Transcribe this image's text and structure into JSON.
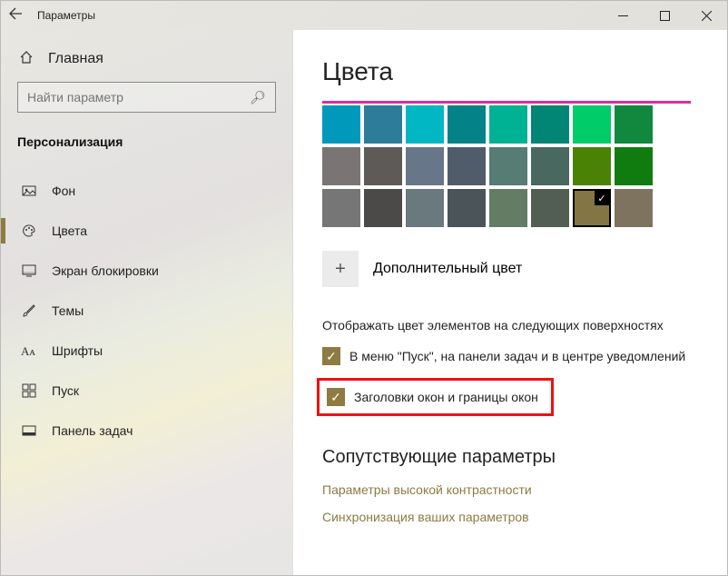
{
  "titlebar": {
    "title": "Параметры"
  },
  "sidebar": {
    "home_label": "Главная",
    "search_placeholder": "Найти параметр",
    "category": "Персонализация",
    "items": [
      {
        "label": "Фон",
        "icon": "picture"
      },
      {
        "label": "Цвета",
        "icon": "palette",
        "active": true
      },
      {
        "label": "Экран блокировки",
        "icon": "lock-screen"
      },
      {
        "label": "Темы",
        "icon": "brush"
      },
      {
        "label": "Шрифты",
        "icon": "font"
      },
      {
        "label": "Пуск",
        "icon": "start"
      },
      {
        "label": "Панель задач",
        "icon": "taskbar"
      }
    ]
  },
  "main": {
    "heading": "Цвета",
    "custom_color_label": "Дополнительный цвет",
    "surfaces_label": "Отображать цвет элементов на следующих поверхностях",
    "cb1_label": "В меню \"Пуск\", на панели задач и в центре уведомлений",
    "cb2_label": "Заголовки окон и границы окон",
    "related_heading": "Сопутствующие параметры",
    "link1": "Параметры высокой контрастности",
    "link2": "Синхронизация ваших параметров",
    "swatches": [
      [
        "#0099bc",
        "#2d7d9a",
        "#00b7c3",
        "#038387",
        "#00b294",
        "#018574",
        "#00cc6a",
        "#10893e"
      ],
      [
        "#7a7574",
        "#5d5a58",
        "#68768a",
        "#515c6b",
        "#567c73",
        "#486860",
        "#498205",
        "#107c10"
      ],
      [
        "#767676",
        "#4c4a48",
        "#69797e",
        "#4a5459",
        "#647c64",
        "#525e54",
        "#847545",
        "#7e735f"
      ]
    ],
    "selected_swatch": "#847545"
  }
}
